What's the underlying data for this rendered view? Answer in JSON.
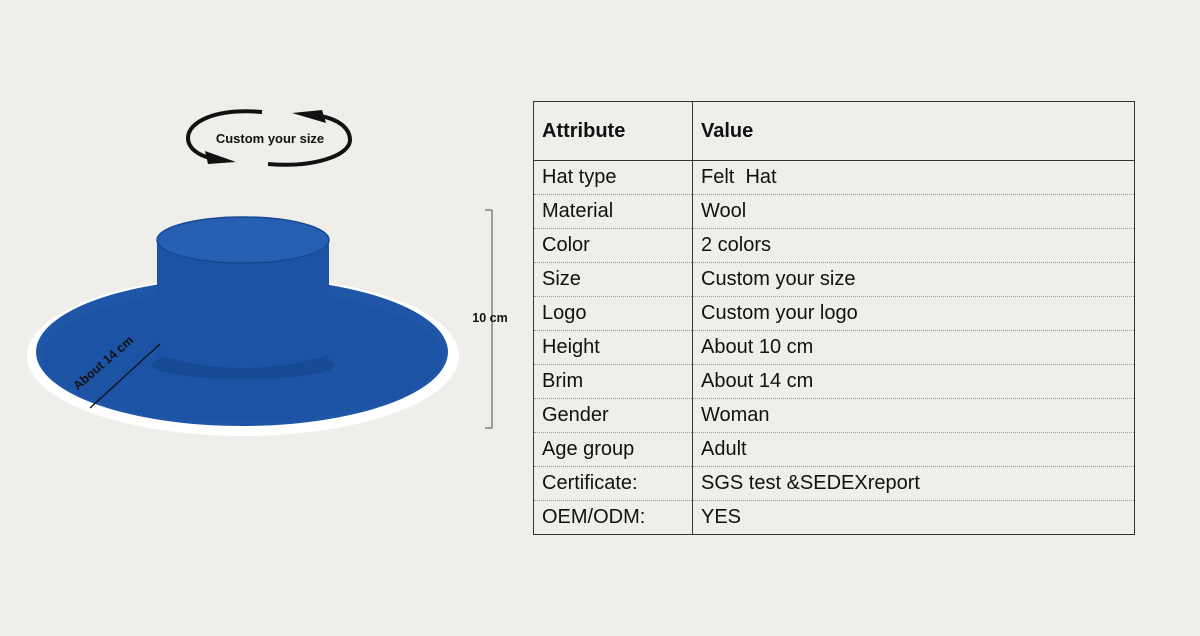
{
  "figure": {
    "callout_label": "Custom your size",
    "height_label": "10 cm",
    "brim_label": "About  14 cm"
  },
  "table": {
    "headers": [
      "Attribute",
      "Value"
    ],
    "rows": [
      [
        "Hat type",
        "Felt  Hat"
      ],
      [
        "Material",
        "Wool"
      ],
      [
        "Color",
        "2 colors"
      ],
      [
        "Size",
        "Custom your size"
      ],
      [
        "Logo",
        "Custom your logo"
      ],
      [
        "Height",
        "About 10 cm"
      ],
      [
        "Brim",
        "About 14 cm"
      ],
      [
        "Gender",
        "Woman"
      ],
      [
        "Age group",
        "Adult"
      ],
      [
        "Certificate:",
        "SGS test &SEDEXreport"
      ],
      [
        "OEM/ODM:",
        "YES"
      ]
    ]
  },
  "colors": {
    "hat": "#1f56a8",
    "hat_shadow": "#164a93",
    "background": "#f0eeea"
  }
}
